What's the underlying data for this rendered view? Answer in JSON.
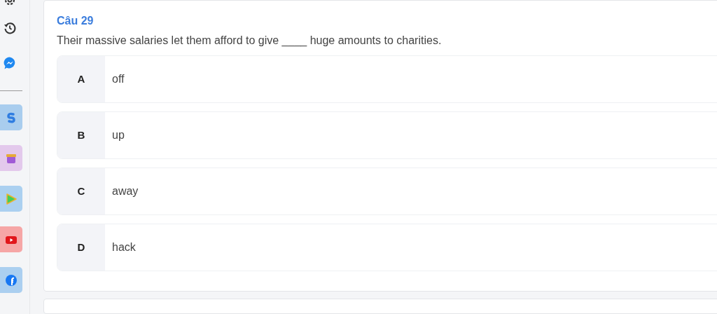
{
  "question": {
    "title": "Câu 29",
    "text": "Their massive salaries let them afford to give ____ huge amounts to charities.",
    "options": [
      {
        "letter": "A",
        "text": "off"
      },
      {
        "letter": "B",
        "text": "up"
      },
      {
        "letter": "C",
        "text": "away"
      },
      {
        "letter": "D",
        "text": "hack"
      }
    ]
  },
  "sidebar": {
    "apps": [
      {
        "kind": "s-logo",
        "color": "#a9cdee"
      },
      {
        "kind": "gift",
        "color": "#e3c9ec"
      },
      {
        "kind": "play",
        "color": "#abd0f0"
      },
      {
        "kind": "youtube",
        "color": "#f6a6a6"
      },
      {
        "kind": "facebook",
        "color": "#abcff0"
      }
    ]
  }
}
